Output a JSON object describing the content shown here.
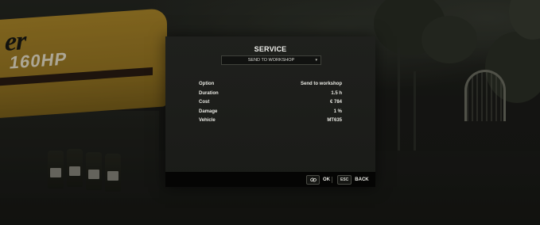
{
  "dialog": {
    "title": "SERVICE",
    "dropdown": {
      "selected": "SEND TO WORKSHOP",
      "chevron": "▾"
    },
    "info_rows": [
      {
        "label": "Option",
        "value": "Send to workshop"
      },
      {
        "label": "Duration",
        "value": "1.5 h"
      },
      {
        "label": "Cost",
        "value": "€ 784"
      },
      {
        "label": "Damage",
        "value": "1 %"
      },
      {
        "label": "Vehicle",
        "value": "MT635"
      }
    ],
    "footer": {
      "ok": {
        "key_icon": "link-icon",
        "label": "OK"
      },
      "back": {
        "key": "ESC",
        "label": "BACK"
      }
    }
  },
  "background": {
    "tractor_decal": "er",
    "tractor_model": "160HP"
  },
  "colors": {
    "panel": "#1d1e1b",
    "footer": "#050504",
    "text": "#f2f2ee",
    "tractor_yellow": "#b08a2a"
  }
}
